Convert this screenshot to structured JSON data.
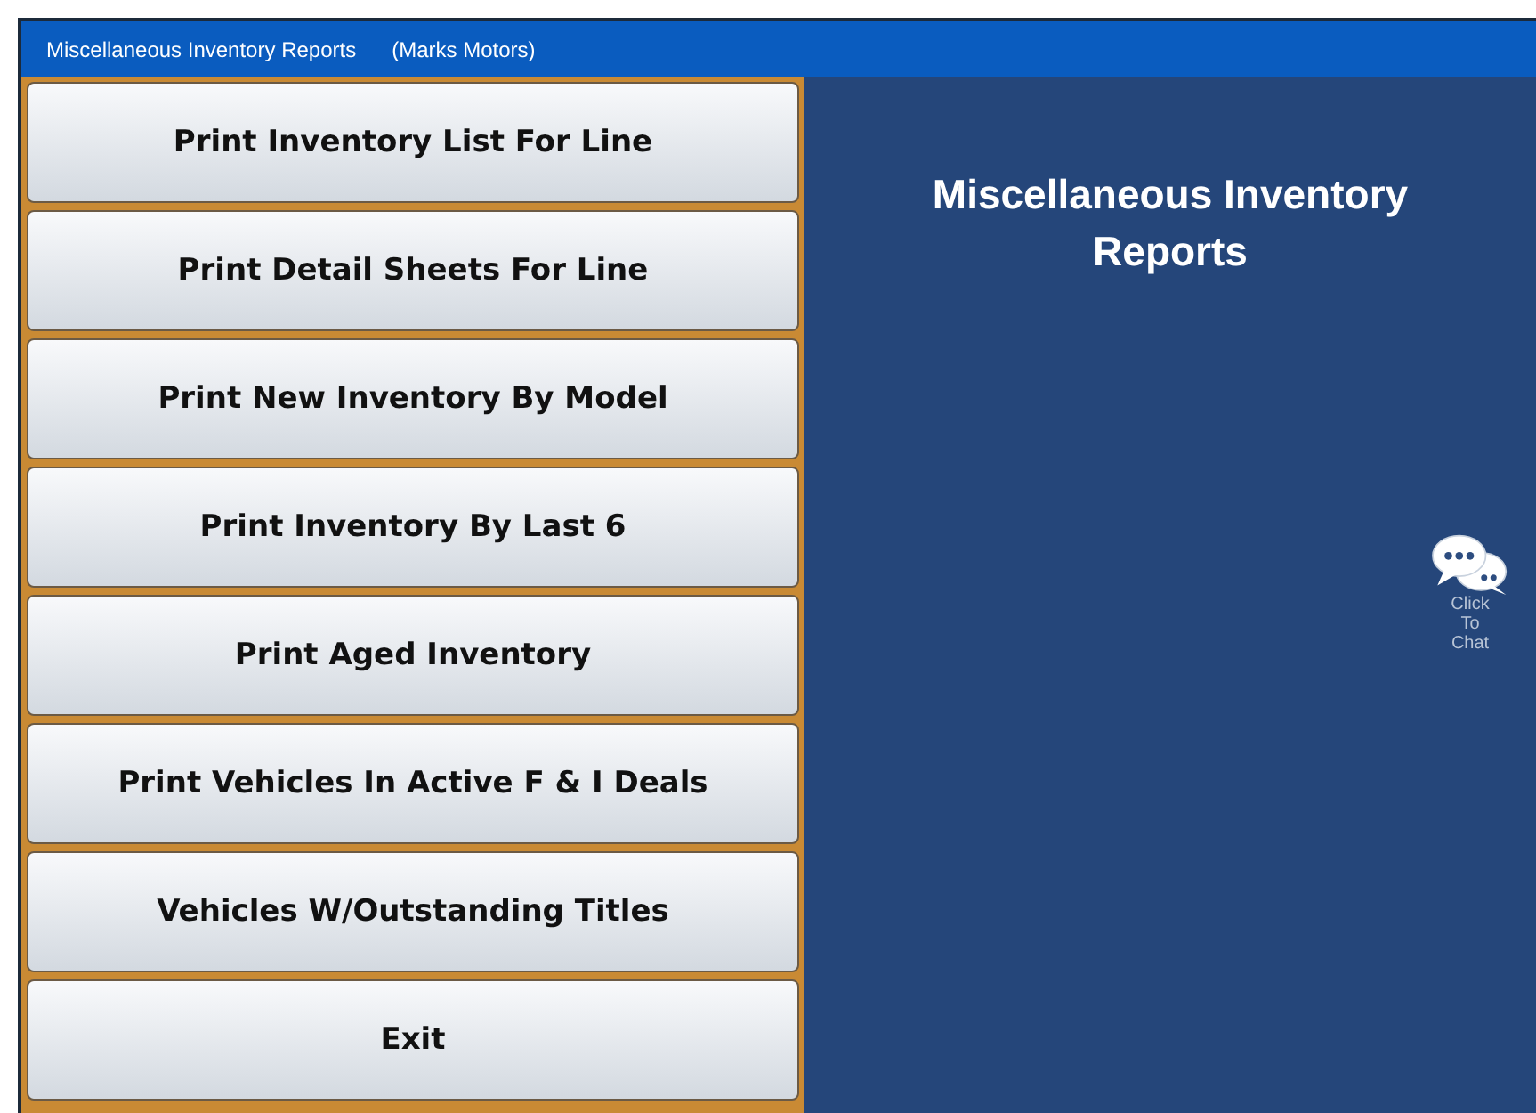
{
  "window": {
    "title": "Miscellaneous Inventory Reports",
    "subtitle": "(Marks Motors)"
  },
  "menu_buttons": [
    {
      "label": "Print Inventory List For Line"
    },
    {
      "label": "Print Detail Sheets For Line"
    },
    {
      "label": "Print New Inventory By Model"
    },
    {
      "label": "Print Inventory By Last 6"
    },
    {
      "label": "Print Aged Inventory"
    },
    {
      "label": "Print Vehicles In Active F & I Deals"
    },
    {
      "label": "Vehicles W/Outstanding Titles"
    },
    {
      "label": "Exit"
    }
  ],
  "panel": {
    "heading": "Miscellaneous Inventory Reports"
  },
  "chat": {
    "label": "Click To Chat"
  }
}
